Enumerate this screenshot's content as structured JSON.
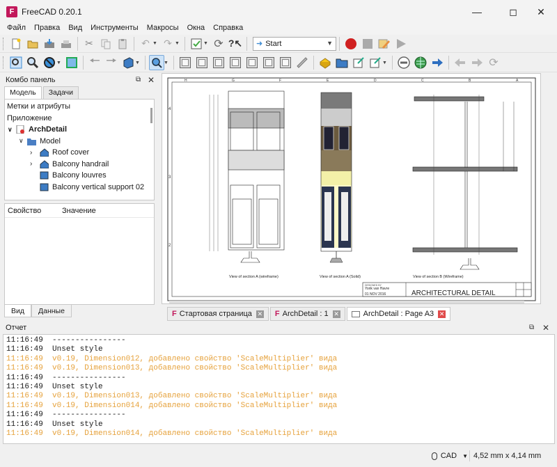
{
  "window": {
    "title": "FreeCAD 0.20.1",
    "icon_label": "F"
  },
  "menu": [
    "Файл",
    "Правка",
    "Вид",
    "Инструменты",
    "Макросы",
    "Окна",
    "Справка"
  ],
  "toolbar": {
    "workbench": "Start"
  },
  "combo": {
    "title": "Комбо панель",
    "tabs": [
      "Модель",
      "Задачи"
    ],
    "tree": {
      "header": "Метки и атрибуты",
      "section": "Приложение",
      "root": "ArchDetail",
      "model": "Model",
      "items": [
        "Roof cover",
        "Balcony handrail",
        "Balcony louvres",
        "Balcony vertical support 02"
      ]
    },
    "props": {
      "col1": "Свойство",
      "col2": "Значение"
    },
    "bottom_tabs": [
      "Вид",
      "Данные"
    ]
  },
  "drawing": {
    "col_labels": [
      "H",
      "G",
      "F",
      "E",
      "D",
      "C",
      "B",
      "A"
    ],
    "row_labels": [
      "4",
      "3",
      "2"
    ],
    "captions": [
      "View of section A (wireframe)",
      "View of section A (Solid)",
      "View of section B (Wireframe)"
    ],
    "title_block": {
      "designed": "DESIGNED BY",
      "author": "Yorik van Havre",
      "date": "01 NOV 2016",
      "title": "ARCHITECTURAL DETAIL"
    }
  },
  "doc_tabs": [
    "Стартовая страница",
    "ArchDetail : 1",
    "ArchDetail : Page A3"
  ],
  "report": {
    "title": "Отчет",
    "lines": [
      {
        "time": "11:16:49",
        "text": "----------------",
        "warn": false
      },
      {
        "time": "11:16:49",
        "text": "Unset style",
        "warn": false
      },
      {
        "time": "11:16:49",
        "text": "v0.19, Dimension012, добавлено свойство 'ScaleMultiplier' вида",
        "warn": true
      },
      {
        "time": "11:16:49",
        "text": "v0.19, Dimension013, добавлено свойство 'ScaleMultiplier' вида",
        "warn": true
      },
      {
        "time": "11:16:49",
        "text": "----------------",
        "warn": false
      },
      {
        "time": "11:16:49",
        "text": "Unset style",
        "warn": false
      },
      {
        "time": "11:16:49",
        "text": "v0.19, Dimension013, добавлено свойство 'ScaleMultiplier' вида",
        "warn": true
      },
      {
        "time": "11:16:49",
        "text": "v0.19, Dimension014, добавлено свойство 'ScaleMultiplier' вида",
        "warn": true
      },
      {
        "time": "11:16:49",
        "text": "----------------",
        "warn": false
      },
      {
        "time": "11:16:49",
        "text": "Unset style",
        "warn": false
      },
      {
        "time": "11:16:49",
        "text": "v0.19, Dimension014, добавлено свойство 'ScaleMultiplier' вида",
        "warn": true
      }
    ]
  },
  "status": {
    "nav": "CAD",
    "dims": "4,52 mm x 4,14 mm"
  },
  "colors": {
    "accent": "#3d8bd3",
    "warn": "#e6a23c",
    "record": "#d02020"
  }
}
